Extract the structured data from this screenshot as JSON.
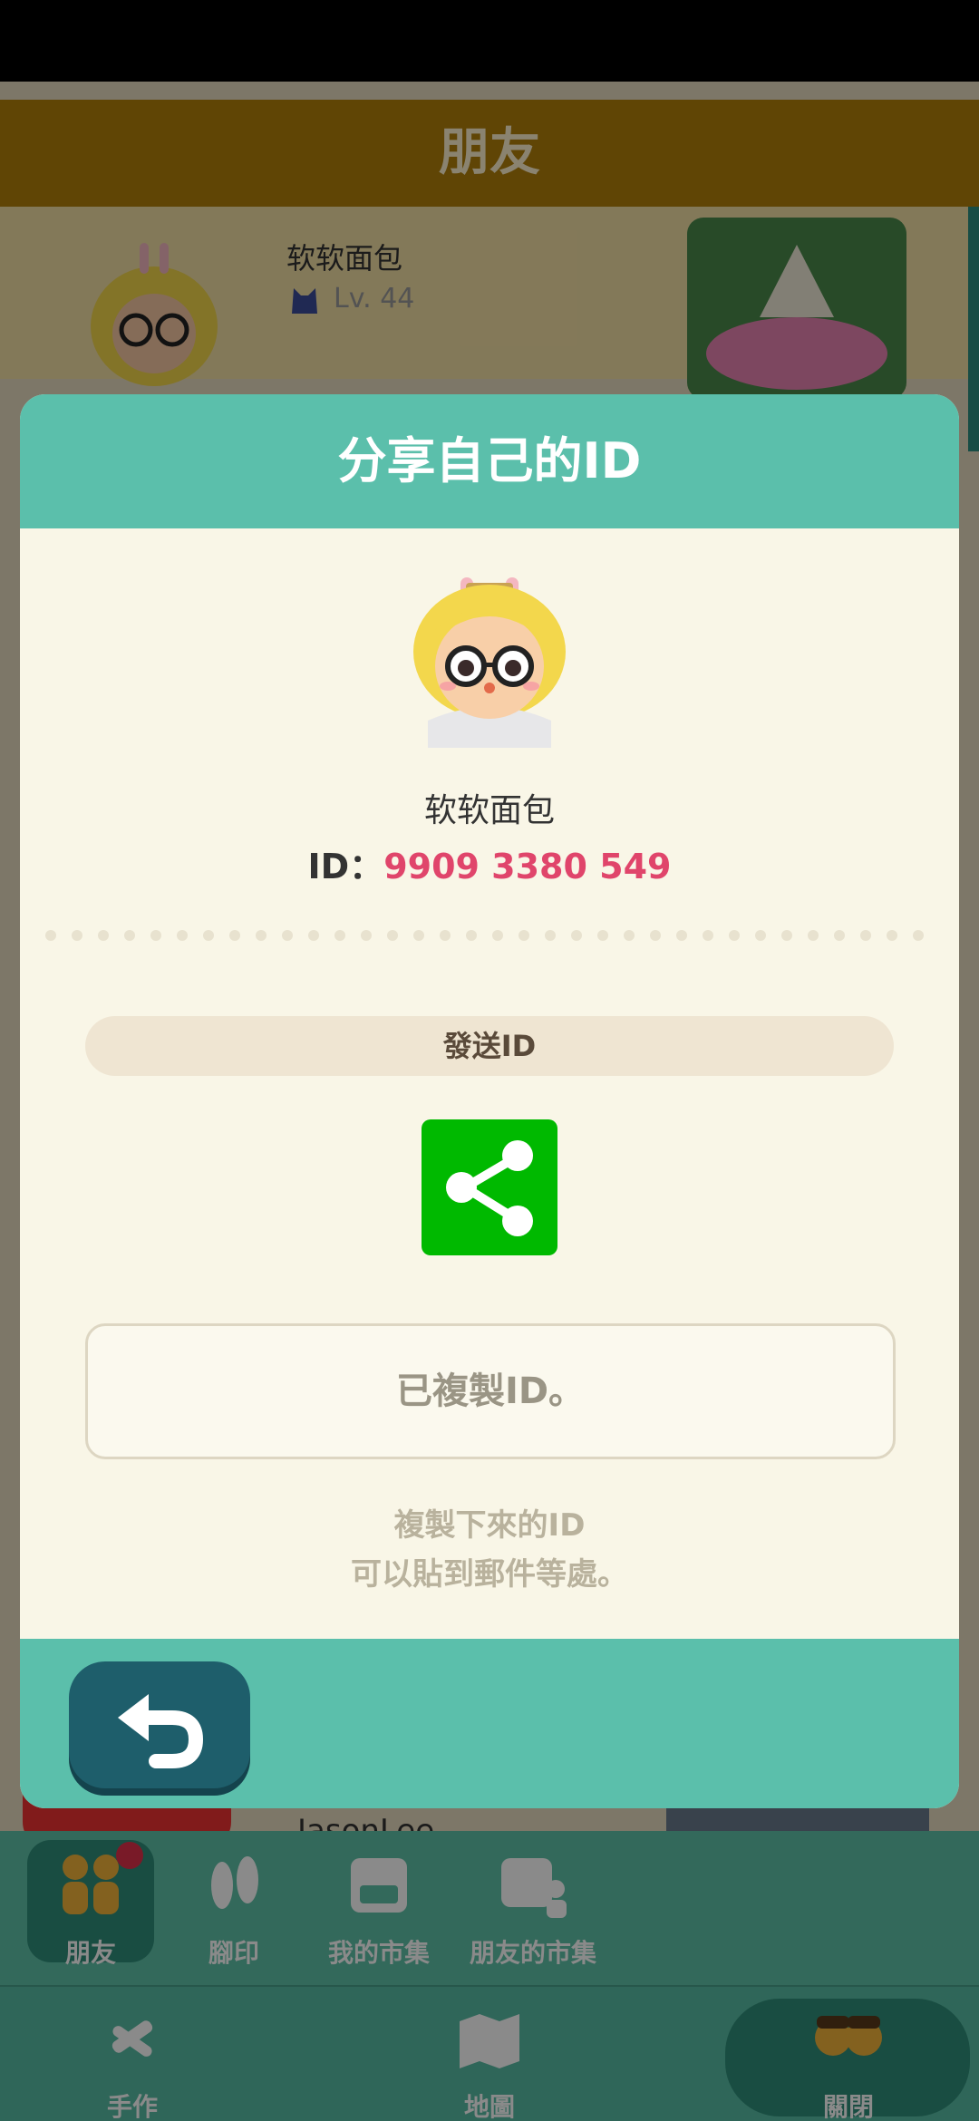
{
  "background": {
    "title": "朋友",
    "friend": {
      "name": "软软面包",
      "level": "Lv. 44"
    },
    "friend2_name": "JasonLee"
  },
  "modal": {
    "title": "分享自己的ID",
    "profile": {
      "name": "软软面包",
      "id_label": "ID：",
      "id_value": "9909 3380 549"
    },
    "send_label": "發送ID",
    "copy_status": "已複製ID。",
    "hint_line1": "複製下來的ID",
    "hint_line2": "可以貼到郵件等處。"
  },
  "nav": {
    "friends": "朋友",
    "footprints": "腳印",
    "my_market": "我的市集",
    "friends_market": "朋友的市集",
    "craft": "手作",
    "map": "地圖",
    "close": "關閉"
  },
  "colors": {
    "accent_teal": "#5bbfab",
    "id_pink": "#e0456b",
    "share_green": "#00b900",
    "back_button": "#1e5e6b"
  },
  "icons": [
    "share-icon",
    "back-arrow-icon",
    "friends-icon",
    "footprints-icon",
    "market-icon",
    "friends-market-icon",
    "craft-icon",
    "map-icon",
    "close-icon"
  ]
}
